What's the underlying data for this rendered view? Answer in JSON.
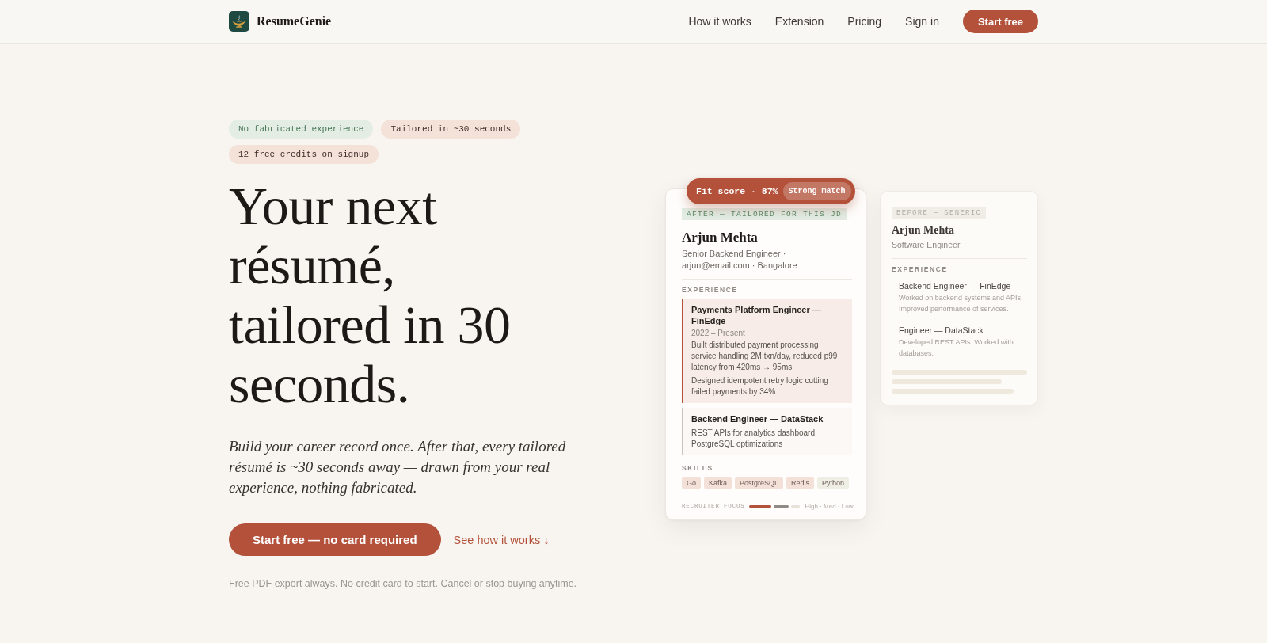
{
  "header": {
    "brand": "ResumeGenie",
    "nav": [
      {
        "label": "How it works"
      },
      {
        "label": "Extension"
      },
      {
        "label": "Pricing"
      },
      {
        "label": "Sign in"
      }
    ],
    "cta": "Start free"
  },
  "hero": {
    "badges": [
      {
        "label": "No fabricated experience",
        "color": "#e3ede4"
      },
      {
        "label": "Tailored in ~30 seconds",
        "color": "#f4e2d9"
      },
      {
        "label": "12 free credits on signup",
        "color": "#f4e2d9"
      }
    ],
    "headline": "Your next résumé, tailored in 30 seconds.",
    "subtitle": "Build your career record once. After that, every tailored résumé is ~30 seconds away — drawn from your real experience, nothing fabricated.",
    "primary_button": "Start free — no card required",
    "secondary_link": "See how it works ↓",
    "footnote": "Free PDF export always. No credit card to start. Cancel or stop buying anytime."
  },
  "after_resume": {
    "fit_score": "Fit score · 87%",
    "match": "Strong match",
    "tag": "AFTER — TAILORED FOR THIS JD",
    "name": "Arjun Mehta",
    "subtitle": "Senior Backend Engineer · arjun@email.com · Bangalore",
    "experience_heading": "EXPERIENCE",
    "experience": [
      {
        "title": "Payments Platform Engineer — FinEdge",
        "dates": "2022 – Present",
        "bullets": [
          "Built distributed payment processing service handling 2M txn/day, reduced p99 latency from 420ms → 95ms",
          "Designed idempotent retry logic cutting failed payments by 34%"
        ],
        "highlighted": true
      },
      {
        "title": "Backend Engineer — DataStack",
        "bullets": [
          "REST APIs for analytics dashboard, PostgreSQL optimizations"
        ],
        "highlighted": false
      }
    ],
    "skills_heading": "SKILLS",
    "skills": [
      {
        "label": "Go",
        "color": "#f3e1d8"
      },
      {
        "label": "Kafka",
        "color": "#f3e1d8"
      },
      {
        "label": "PostgreSQL",
        "color": "#f3e1d8"
      },
      {
        "label": "Redis",
        "color": "#f3e1d8"
      },
      {
        "label": "Python",
        "color": "#efeee5"
      }
    ],
    "focus": {
      "label": "RECRUITER FOCUS",
      "bars": [
        {
          "color": "#b3513a"
        },
        {
          "color": "#8e8b85"
        },
        {
          "color": "#e7e1d9"
        }
      ],
      "legend": "High · Med · Low"
    }
  },
  "before_resume": {
    "tag": "BEFORE — GENERIC",
    "name": "Arjun Mehta",
    "subtitle": "Software Engineer",
    "experience_heading": "EXPERIENCE",
    "experience": [
      {
        "title": "Backend Engineer — FinEdge",
        "description": "Worked on backend systems and APIs. Improved performance of services."
      },
      {
        "title": "Engineer — DataStack",
        "description": "Developed REST APIs. Worked with databases."
      }
    ]
  }
}
